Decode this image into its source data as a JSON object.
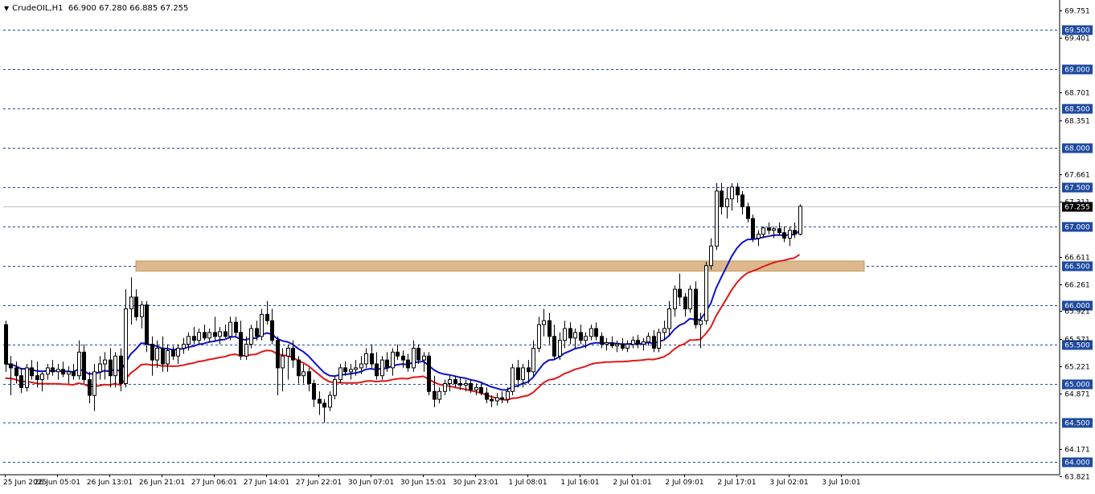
{
  "header": {
    "symbol_label": "CrudeOIL,H1",
    "ohlc_label": "66.900 67.280 66.885 67.255"
  },
  "colors": {
    "bull_candle": "#ffffff",
    "bear_candle": "#000000",
    "candle_outline": "#000000",
    "ma_fast": "#1010c8",
    "ma_slow": "#e01818",
    "zone_fill": "#dcb88c",
    "level_line": "#1e4aa0",
    "grid_line": "#8c8c8c",
    "price_tag_bg": "#000000",
    "price_tag_text": "#ffffff"
  },
  "chart_data": {
    "type": "candlestick",
    "ylim": [
      63.84,
      69.86
    ],
    "price_axis_ticks": [
      "69.751",
      "69.401",
      "68.701",
      "68.351",
      "67.661",
      "67.311",
      "66.611",
      "66.261",
      "65.921",
      "65.571",
      "65.221",
      "64.871",
      "64.171",
      "63.821"
    ],
    "level_lines": [
      {
        "label": "69.500",
        "value": 69.5
      },
      {
        "label": "69.000",
        "value": 69.0
      },
      {
        "label": "68.500",
        "value": 68.5
      },
      {
        "label": "68.000",
        "value": 68.0
      },
      {
        "label": "67.500",
        "value": 67.5
      },
      {
        "label": "67.000",
        "value": 67.0
      },
      {
        "label": "66.500",
        "value": 66.5
      },
      {
        "label": "66.000",
        "value": 66.0
      },
      {
        "label": "65.500",
        "value": 65.5
      },
      {
        "label": "65.000",
        "value": 65.0
      },
      {
        "label": "64.500",
        "value": 64.5
      },
      {
        "label": "64.000",
        "value": 64.0
      }
    ],
    "current_price": {
      "label": "67.255",
      "value": 67.255
    },
    "zone": {
      "from": 66.43,
      "to": 66.56,
      "start_bar": 25
    },
    "time_labels": [
      {
        "label": "25 Jun 2025",
        "bar": 0
      },
      {
        "label": "26 Jun 05:01",
        "bar": 10
      },
      {
        "label": "26 Jun 13:01",
        "bar": 20
      },
      {
        "label": "26 Jun 21:01",
        "bar": 30
      },
      {
        "label": "27 Jun 06:01",
        "bar": 40
      },
      {
        "label": "27 Jun 14:01",
        "bar": 50
      },
      {
        "label": "27 Jun 22:01",
        "bar": 60
      },
      {
        "label": "30 Jun 07:01",
        "bar": 70
      },
      {
        "label": "30 Jun 15:01",
        "bar": 80
      },
      {
        "label": "30 Jun 23:01",
        "bar": 90
      },
      {
        "label": "1 Jul 08:01",
        "bar": 100
      },
      {
        "label": "1 Jul 16:01",
        "bar": 110
      },
      {
        "label": "2 Jul 01:01",
        "bar": 120
      },
      {
        "label": "2 Jul 09:01",
        "bar": 130
      },
      {
        "label": "2 Jul 17:01",
        "bar": 140
      },
      {
        "label": "3 Jul 02:01",
        "bar": 150
      },
      {
        "label": "3 Jul 10:01",
        "bar": 160
      }
    ],
    "ohlc": [
      [
        65.75,
        65.8,
        65.15,
        65.25
      ],
      [
        65.25,
        65.35,
        64.85,
        65.2
      ],
      [
        65.2,
        65.28,
        65.0,
        65.1
      ],
      [
        65.1,
        65.2,
        64.88,
        64.95
      ],
      [
        64.95,
        65.25,
        64.9,
        65.2
      ],
      [
        65.2,
        65.3,
        65.05,
        65.1
      ],
      [
        65.1,
        65.28,
        64.95,
        65.05
      ],
      [
        65.05,
        65.15,
        64.9,
        65.12
      ],
      [
        65.12,
        65.25,
        65.05,
        65.2
      ],
      [
        65.2,
        65.3,
        65.1,
        65.15
      ],
      [
        65.15,
        65.25,
        65.05,
        65.18
      ],
      [
        65.18,
        65.28,
        65.08,
        65.12
      ],
      [
        65.12,
        65.22,
        65.0,
        65.15
      ],
      [
        65.15,
        65.25,
        65.05,
        65.1
      ],
      [
        65.1,
        65.55,
        65.05,
        65.4
      ],
      [
        65.4,
        65.5,
        65.0,
        65.05
      ],
      [
        65.05,
        65.15,
        64.75,
        64.85
      ],
      [
        64.85,
        65.25,
        64.65,
        65.15
      ],
      [
        65.15,
        65.35,
        65.05,
        65.25
      ],
      [
        65.25,
        65.4,
        65.05,
        65.3
      ],
      [
        65.3,
        65.45,
        64.95,
        65.1
      ],
      [
        65.1,
        65.4,
        64.95,
        65.35
      ],
      [
        65.35,
        65.45,
        64.9,
        65.0
      ],
      [
        65.0,
        66.2,
        64.95,
        65.95
      ],
      [
        65.95,
        66.35,
        65.75,
        66.1
      ],
      [
        66.1,
        66.2,
        65.8,
        65.85
      ],
      [
        65.85,
        66.05,
        65.7,
        66.0
      ],
      [
        66.0,
        66.05,
        65.4,
        65.5
      ],
      [
        65.5,
        65.6,
        65.1,
        65.3
      ],
      [
        65.3,
        65.55,
        65.2,
        65.45
      ],
      [
        65.45,
        65.6,
        65.15,
        65.25
      ],
      [
        65.25,
        65.5,
        65.15,
        65.42
      ],
      [
        65.42,
        65.48,
        65.3,
        65.35
      ],
      [
        65.35,
        65.5,
        65.25,
        65.45
      ],
      [
        65.45,
        65.58,
        65.38,
        65.5
      ],
      [
        65.5,
        65.65,
        65.42,
        65.6
      ],
      [
        65.6,
        65.72,
        65.5,
        65.55
      ],
      [
        65.55,
        65.7,
        65.5,
        65.65
      ],
      [
        65.65,
        65.75,
        65.55,
        65.58
      ],
      [
        65.58,
        65.7,
        65.52,
        65.65
      ],
      [
        65.65,
        65.85,
        65.55,
        65.6
      ],
      [
        65.6,
        65.72,
        65.5,
        65.66
      ],
      [
        65.66,
        65.75,
        65.58,
        65.6
      ],
      [
        65.6,
        65.85,
        65.55,
        65.78
      ],
      [
        65.78,
        65.85,
        65.6,
        65.65
      ],
      [
        65.65,
        65.8,
        65.3,
        65.35
      ],
      [
        65.35,
        65.6,
        65.3,
        65.5
      ],
      [
        65.5,
        65.75,
        65.45,
        65.7
      ],
      [
        65.7,
        65.8,
        65.55,
        65.6
      ],
      [
        65.6,
        65.95,
        65.55,
        65.88
      ],
      [
        65.88,
        66.05,
        65.75,
        65.8
      ],
      [
        65.8,
        65.95,
        65.5,
        65.55
      ],
      [
        65.55,
        65.6,
        64.85,
        65.2
      ],
      [
        65.2,
        65.45,
        64.9,
        65.35
      ],
      [
        65.35,
        65.5,
        65.05,
        65.45
      ],
      [
        65.45,
        65.55,
        65.2,
        65.3
      ],
      [
        65.3,
        65.35,
        65.0,
        65.1
      ],
      [
        65.1,
        65.25,
        65.0,
        65.15
      ],
      [
        65.15,
        65.2,
        64.9,
        65.0
      ],
      [
        65.0,
        65.05,
        64.7,
        64.8
      ],
      [
        64.8,
        64.9,
        64.6,
        64.75
      ],
      [
        64.75,
        64.8,
        64.5,
        64.7
      ],
      [
        64.7,
        64.9,
        64.65,
        64.85
      ],
      [
        64.85,
        65.1,
        64.8,
        65.05
      ],
      [
        65.05,
        65.25,
        65.0,
        65.2
      ],
      [
        65.2,
        65.28,
        65.1,
        65.15
      ],
      [
        65.15,
        65.25,
        65.05,
        65.18
      ],
      [
        65.18,
        65.3,
        65.1,
        65.2
      ],
      [
        65.2,
        65.35,
        65.12,
        65.25
      ],
      [
        65.25,
        65.45,
        65.2,
        65.38
      ],
      [
        65.38,
        65.5,
        65.2,
        65.25
      ],
      [
        65.25,
        65.4,
        65.05,
        65.1
      ],
      [
        65.1,
        65.35,
        65.05,
        65.3
      ],
      [
        65.3,
        65.4,
        65.15,
        65.2
      ],
      [
        65.2,
        65.45,
        65.1,
        65.4
      ],
      [
        65.4,
        65.5,
        65.3,
        65.35
      ],
      [
        65.35,
        65.42,
        65.2,
        65.3
      ],
      [
        65.3,
        65.38,
        65.15,
        65.2
      ],
      [
        65.2,
        65.55,
        65.15,
        65.45
      ],
      [
        65.45,
        65.5,
        65.25,
        65.3
      ],
      [
        65.3,
        65.4,
        65.15,
        65.35
      ],
      [
        65.35,
        65.4,
        64.85,
        64.9
      ],
      [
        64.9,
        65.1,
        64.7,
        64.8
      ],
      [
        64.8,
        64.95,
        64.75,
        64.9
      ],
      [
        64.9,
        65.05,
        64.85,
        65.0
      ],
      [
        65.0,
        65.1,
        64.9,
        65.05
      ],
      [
        65.05,
        65.1,
        64.95,
        65.0
      ],
      [
        65.0,
        65.08,
        64.92,
        64.98
      ],
      [
        64.98,
        65.05,
        64.9,
        65.0
      ],
      [
        65.0,
        65.05,
        64.88,
        64.92
      ],
      [
        64.92,
        65.0,
        64.85,
        64.95
      ],
      [
        64.95,
        65.0,
        64.85,
        64.88
      ],
      [
        64.88,
        64.95,
        64.75,
        64.8
      ],
      [
        64.8,
        64.85,
        64.7,
        64.78
      ],
      [
        64.78,
        64.88,
        64.72,
        64.82
      ],
      [
        64.82,
        64.9,
        64.75,
        64.8
      ],
      [
        64.8,
        64.95,
        64.75,
        64.9
      ],
      [
        64.9,
        65.25,
        64.85,
        65.2
      ],
      [
        65.2,
        65.3,
        64.95,
        65.05
      ],
      [
        65.05,
        65.25,
        64.95,
        65.2
      ],
      [
        65.2,
        65.3,
        65.0,
        65.15
      ],
      [
        65.15,
        65.55,
        65.1,
        65.45
      ],
      [
        65.45,
        65.85,
        65.4,
        65.75
      ],
      [
        65.75,
        65.95,
        65.6,
        65.8
      ],
      [
        65.8,
        65.9,
        65.5,
        65.6
      ],
      [
        65.6,
        65.75,
        65.3,
        65.35
      ],
      [
        65.35,
        65.65,
        65.3,
        65.55
      ],
      [
        65.55,
        65.8,
        65.45,
        65.7
      ],
      [
        65.7,
        65.78,
        65.5,
        65.58
      ],
      [
        65.58,
        65.7,
        65.45,
        65.65
      ],
      [
        65.65,
        65.75,
        65.5,
        65.55
      ],
      [
        65.55,
        65.65,
        65.45,
        65.6
      ],
      [
        65.6,
        65.75,
        65.55,
        65.7
      ],
      [
        65.7,
        65.78,
        65.55,
        65.6
      ],
      [
        65.6,
        65.65,
        65.45,
        65.5
      ],
      [
        65.5,
        65.58,
        65.42,
        65.52
      ],
      [
        65.52,
        65.6,
        65.45,
        65.48
      ],
      [
        65.48,
        65.55,
        65.4,
        65.5
      ],
      [
        65.5,
        65.58,
        65.42,
        65.45
      ],
      [
        65.45,
        65.55,
        65.4,
        65.5
      ],
      [
        65.5,
        65.6,
        65.45,
        65.55
      ],
      [
        65.55,
        65.62,
        65.45,
        65.5
      ],
      [
        65.5,
        65.58,
        65.42,
        65.53
      ],
      [
        65.53,
        65.65,
        65.48,
        65.6
      ],
      [
        65.6,
        65.68,
        65.4,
        65.45
      ],
      [
        65.45,
        65.7,
        65.4,
        65.65
      ],
      [
        65.65,
        65.8,
        65.55,
        65.7
      ],
      [
        65.7,
        66.05,
        65.6,
        65.95
      ],
      [
        65.95,
        66.25,
        65.85,
        66.2
      ],
      [
        66.2,
        66.4,
        66.0,
        66.1
      ],
      [
        66.1,
        66.15,
        65.85,
        65.95
      ],
      [
        65.95,
        66.25,
        65.9,
        66.2
      ],
      [
        66.2,
        66.3,
        65.7,
        65.75
      ],
      [
        65.75,
        65.9,
        65.45,
        65.8
      ],
      [
        65.8,
        66.55,
        65.75,
        66.5
      ],
      [
        66.5,
        66.85,
        66.45,
        66.75
      ],
      [
        66.75,
        67.55,
        66.7,
        67.45
      ],
      [
        67.45,
        67.55,
        67.15,
        67.25
      ],
      [
        67.25,
        67.5,
        67.1,
        67.35
      ],
      [
        67.35,
        67.55,
        67.2,
        67.5
      ],
      [
        67.5,
        67.55,
        67.3,
        67.4
      ],
      [
        67.4,
        67.45,
        67.15,
        67.25
      ],
      [
        67.25,
        67.3,
        67.05,
        67.1
      ],
      [
        67.1,
        67.15,
        66.8,
        66.85
      ],
      [
        66.85,
        66.95,
        66.75,
        66.9
      ],
      [
        66.9,
        67.0,
        66.85,
        66.98
      ],
      [
        66.98,
        67.05,
        66.9,
        66.95
      ],
      [
        66.95,
        67.0,
        66.85,
        66.97
      ],
      [
        66.97,
        67.05,
        66.88,
        66.92
      ],
      [
        66.92,
        67.0,
        66.8,
        66.85
      ],
      [
        66.85,
        67.0,
        66.75,
        66.95
      ],
      [
        66.95,
        67.05,
        66.85,
        66.9
      ],
      [
        66.9,
        67.28,
        66.885,
        67.255
      ]
    ]
  }
}
